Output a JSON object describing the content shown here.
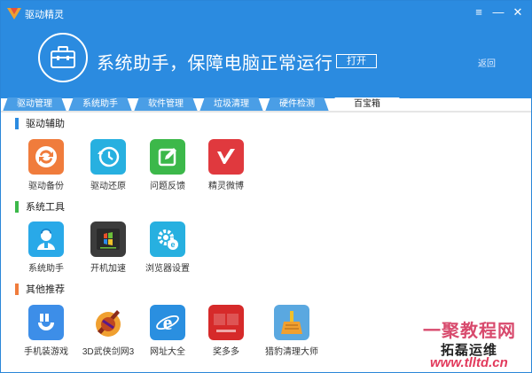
{
  "window": {
    "app_title": "驱动精灵",
    "controls": [
      "≡",
      "—",
      "✕"
    ]
  },
  "banner": {
    "text": "系统助手，保障电脑正常运行",
    "open_label": "打开",
    "back_label": "返回"
  },
  "tabs": [
    {
      "label": "驱动管理"
    },
    {
      "label": "系统助手"
    },
    {
      "label": "软件管理"
    },
    {
      "label": "垃圾清理"
    },
    {
      "label": "硬件检测"
    },
    {
      "label": "百宝箱"
    }
  ],
  "sections": [
    {
      "title": "驱动辅助",
      "accent": "#2b8be0",
      "apps": [
        {
          "label": "驱动备份",
          "icon": "driver-backup-icon",
          "color": "#f07c3c"
        },
        {
          "label": "驱动还原",
          "icon": "driver-restore-icon",
          "color": "#27b0e0"
        },
        {
          "label": "问题反馈",
          "icon": "feedback-icon",
          "color": "#3cb84a"
        },
        {
          "label": "精灵微博",
          "icon": "weibo-icon",
          "color": "#e0393e"
        }
      ]
    },
    {
      "title": "系统工具",
      "accent": "#3cb84a",
      "apps": [
        {
          "label": "系统助手",
          "icon": "system-assistant-icon",
          "color": "#29a9e8"
        },
        {
          "label": "开机加速",
          "icon": "boot-speedup-icon",
          "color": "#3c3c3c"
        },
        {
          "label": "浏览器设置",
          "icon": "browser-settings-icon",
          "color": "#27b0e0"
        }
      ]
    },
    {
      "title": "其他推荐",
      "accent": "#f07c3c",
      "apps": [
        {
          "label": "手机装游戏",
          "icon": "phone-game-icon",
          "color": "#3d8ee8"
        },
        {
          "label": "3D武侠剑网3",
          "icon": "jx3-game-icon",
          "color": "#c04820"
        },
        {
          "label": "网址大全",
          "icon": "ie-icon",
          "color": "#2a8fe0"
        },
        {
          "label": "奖多多",
          "icon": "lottery-icon",
          "color": "#d62a2a"
        },
        {
          "label": "猎豹清理大师",
          "icon": "cleanmaster-icon",
          "color": "#5aa8e0"
        }
      ]
    }
  ],
  "watermark": {
    "line1": "一聚教程网",
    "line2": "拓磊运维",
    "url": "www.tlltd.cn"
  }
}
